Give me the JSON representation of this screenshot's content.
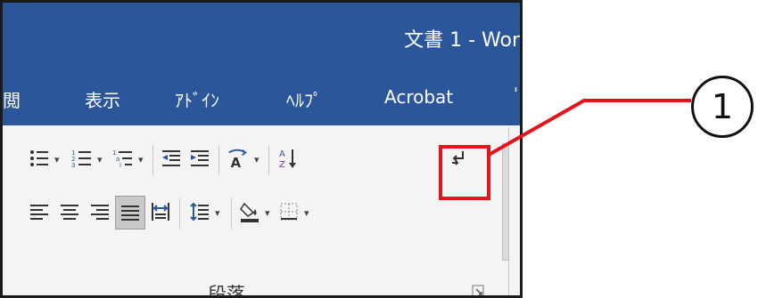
{
  "window": {
    "title": "文書 1  -  Wor"
  },
  "tabs": [
    {
      "label": "閲"
    },
    {
      "label": "表示"
    },
    {
      "label": "ｱﾄﾞｲﾝ"
    },
    {
      "label": "ﾍﾙﾌﾟ"
    },
    {
      "label": "Acrobat"
    }
  ],
  "tab_overflow": "'",
  "ribbon": {
    "group_label": "段落",
    "dropdown_arrow": "▾"
  },
  "callout": {
    "number": "1",
    "color": "#e3141c"
  },
  "colors": {
    "titlebar": "#2b579a",
    "ribbon_bg": "#f4f4f4",
    "accent": "#e3141c"
  }
}
